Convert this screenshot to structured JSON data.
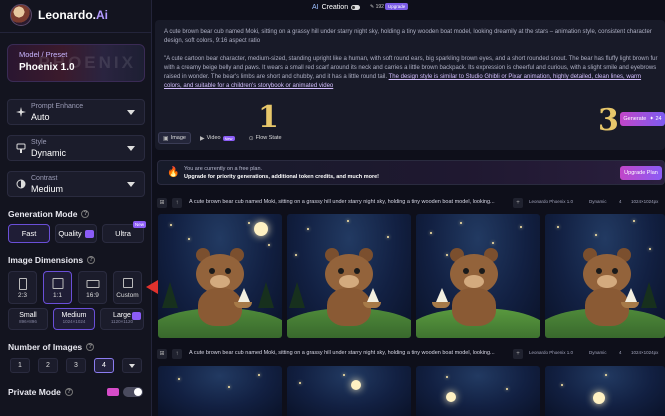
{
  "app": {
    "name": "Leonardo.",
    "name_suffix": "Ai"
  },
  "sidebar": {
    "model": {
      "label": "Model / Preset",
      "value": "Phoenix 1.0",
      "watermark": "PHOENIX"
    },
    "prompt_enhance": {
      "label": "Prompt Enhance",
      "value": "Auto"
    },
    "style": {
      "label": "Style",
      "value": "Dynamic"
    },
    "contrast": {
      "label": "Contrast",
      "value": "Medium"
    },
    "generation_mode": {
      "title": "Generation Mode",
      "options": [
        "Fast",
        "Quality",
        "Ultra"
      ],
      "selected": "Fast",
      "ultra_badge": "New"
    },
    "image_dimensions": {
      "title": "Image Dimensions",
      "ratios": [
        "2:3",
        "1:1",
        "16:9",
        "Custom"
      ],
      "selected_ratio": "1:1",
      "sizes": [
        {
          "label": "Small",
          "detail": "896×896"
        },
        {
          "label": "Medium",
          "detail": "1024×1024"
        },
        {
          "label": "Large",
          "detail": "1120×1120"
        }
      ],
      "selected_size": "Medium"
    },
    "number_of_images": {
      "title": "Number of Images",
      "options": [
        "1",
        "2",
        "3",
        "4"
      ],
      "selected": "4"
    },
    "private_mode": {
      "title": "Private Mode",
      "enabled": false
    }
  },
  "topbar": {
    "title_a": "AI",
    "title_b": "Creation",
    "tokens": "✎ 192",
    "upgrade": "Upgrade"
  },
  "prompt": {
    "p1": "A cute brown bear cub named Moki, sitting on a grassy hill under starry night sky, holding a tiny wooden boat model, looking dreamily at the stars – animation style, consistent character design, soft colors, 9:16 aspect ratio",
    "p2a": "\"A cute cartoon bear character, medium-sized, standing upright like a human, with soft round ears, big sparkling brown eyes, and a short rounded snout. The bear has fluffy light brown fur with a creamy beige belly and paws. It wears a small red scarf around its neck and carries a little brown backpack. Its expression is cheerful and curious, with a slight smile and eyebrows raised in wonder. The bear's limbs are short and chubby, and it has a little round tail. ",
    "p2b": "The design style is similar to Studio Ghibli or Pixar animation, highly detailed, clean lines, warm colors, and suitable for a children's storybook or animated video"
  },
  "tabs": [
    {
      "label": "Image",
      "icon": "image-icon"
    },
    {
      "label": "Video",
      "icon": "video-icon",
      "badge": "New"
    },
    {
      "label": "Flow State",
      "icon": "flow-icon"
    }
  ],
  "generate": {
    "label": "Generate",
    "cost": "✦ 24"
  },
  "annotations": {
    "one": "1",
    "two": "2",
    "three": "3",
    "color": "#e7c76a",
    "arrow_color": "#e0322d"
  },
  "banner": {
    "line1": "You are currently on a free plan.",
    "line2": "Upgrade for priority generations, additional token credits, and much more!",
    "button": "Upgrade Plan"
  },
  "generations": [
    {
      "prompt": "A cute brown bear cub named Moki, sitting on a grassy hill under starry night sky, holding a tiny wooden boat model, looking...",
      "model": "Leonardo Phoenix 1.0",
      "style": "Dynamic",
      "count": "4",
      "size": "1024×1024px"
    },
    {
      "prompt": "A cute brown bear cub named Moki, sitting on a grassy hill under starry night sky, holding a tiny wooden boat model, looking...",
      "model": "Leonardo Phoenix 1.0",
      "style": "Dynamic",
      "count": "4",
      "size": "1024×1024px"
    }
  ],
  "colors": {
    "accent": "#8b5cf6",
    "brand_gradient_start": "#c146c8",
    "background": "#0e0f1a"
  }
}
